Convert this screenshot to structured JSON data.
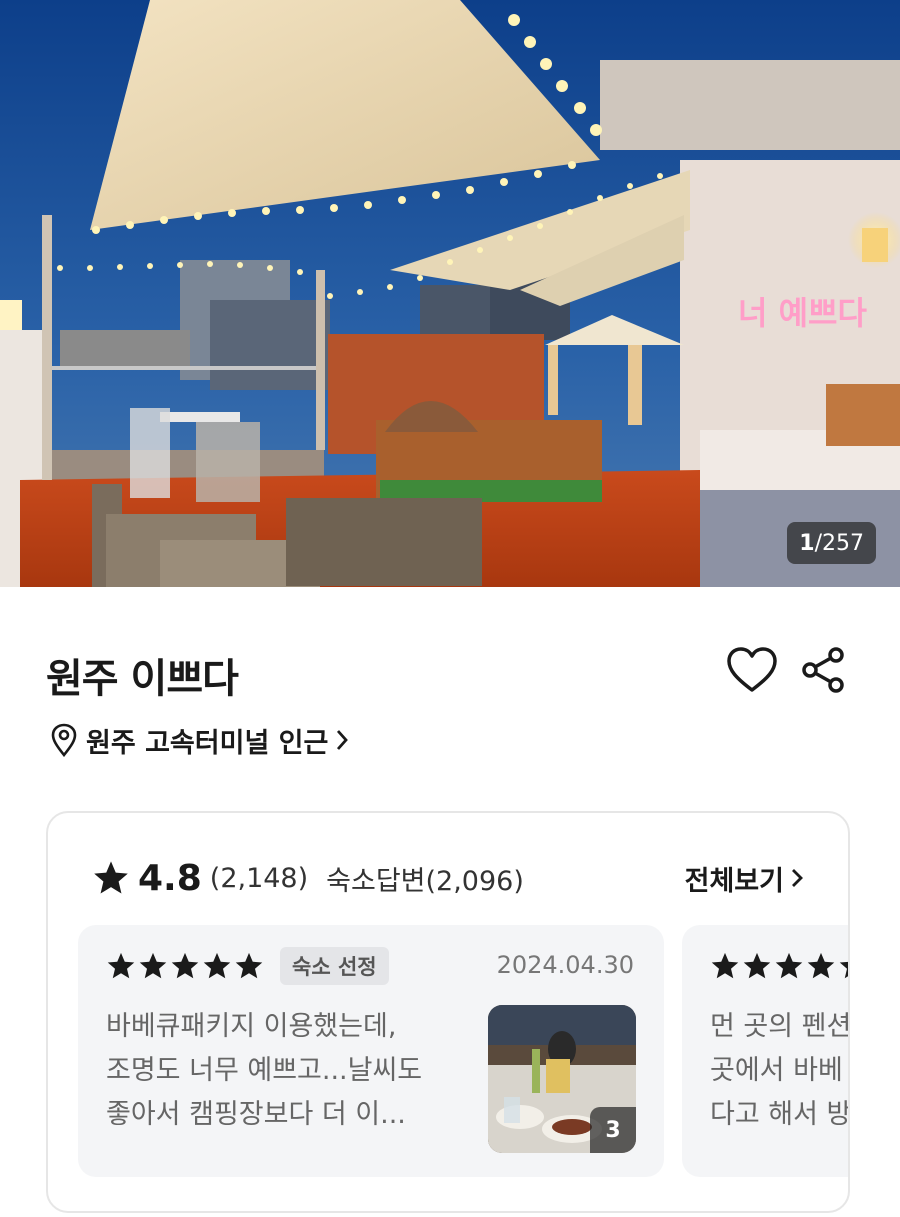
{
  "hero": {
    "counter_current": "1",
    "counter_total": "/257",
    "sign_text": "너 예쁘다"
  },
  "property": {
    "name": "원주 이쁘다",
    "location": "원주 고속터미널 인근"
  },
  "reviews_summary": {
    "score": "4.8",
    "count": "(2,148)",
    "answers": "숙소답변(2,096)",
    "view_all": "전체보기",
    "star_color": "#1a1a1a"
  },
  "reviews": [
    {
      "rating": 5,
      "badge": "숙소 선정",
      "date": "2024.04.30",
      "lines": [
        "바베큐패키지 이용했는데,",
        "조명도 너무 예쁘고...날씨도",
        "좋아서 캠핑장보다 더 이..."
      ],
      "photo_count": "3"
    },
    {
      "rating": 5,
      "lines": [
        "먼 곳의 펜션",
        "곳에서 바베",
        "다고 해서 방"
      ]
    }
  ],
  "icons": {
    "favorite": "heart-icon",
    "share": "share-icon",
    "location": "location-pin-icon",
    "arrow": "chevron-right-icon",
    "rating": "star-icon"
  }
}
